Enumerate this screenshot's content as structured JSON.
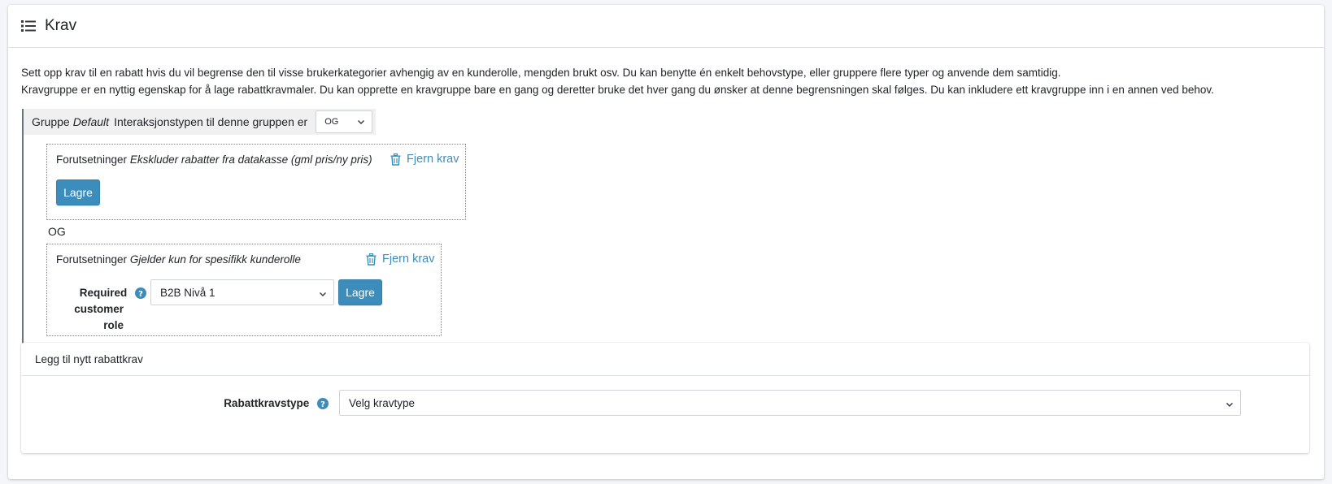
{
  "header": {
    "icon": "list-icon",
    "title": "Krav"
  },
  "description": {
    "line1": "Sett opp krav til en rabatt hvis du vil begrense den til visse brukerkategorier avhengig av en kunderolle, mengden brukt osv. Du kan benytte én enkelt behovstype, eller gruppere flere typer og anvende dem samtidig.",
    "line2": "Kravgruppe er en nyttig egenskap for å lage rabattkravmaler. Du kan opprette en kravgruppe bare en gang og deretter bruke det hver gang du ønsker at denne begrensningen skal følges. Du kan inkludere ett kravgruppe inn i en annen ved behov."
  },
  "group": {
    "label": "Gruppe",
    "name": "Default",
    "interaction_text": "Interaksjonstypen til denne gruppen er",
    "interaction_value": "OG"
  },
  "requirements": [
    {
      "prefix": "Forutsetninger",
      "name": "Ekskluder rabatter fra datakasse (gml pris/ny pris)",
      "remove_label": "Fjern krav",
      "save_label": "Lagre"
    },
    {
      "prefix": "Forutsetninger",
      "name": "Gjelder kun for spesifikk kunderolle",
      "remove_label": "Fjern krav",
      "field_label_line1": "Required",
      "field_label_line2": "customer role",
      "field_value": "B2B Nivå 1",
      "save_label": "Lagre"
    }
  ],
  "operator_label": "OG",
  "new_requirement": {
    "title": "Legg til nytt rabattkrav",
    "field_label": "Rabattkravstype",
    "select_placeholder": "Velg kravtype"
  },
  "colors": {
    "accent": "#3c8dbc",
    "help": "#3c8dbc"
  }
}
